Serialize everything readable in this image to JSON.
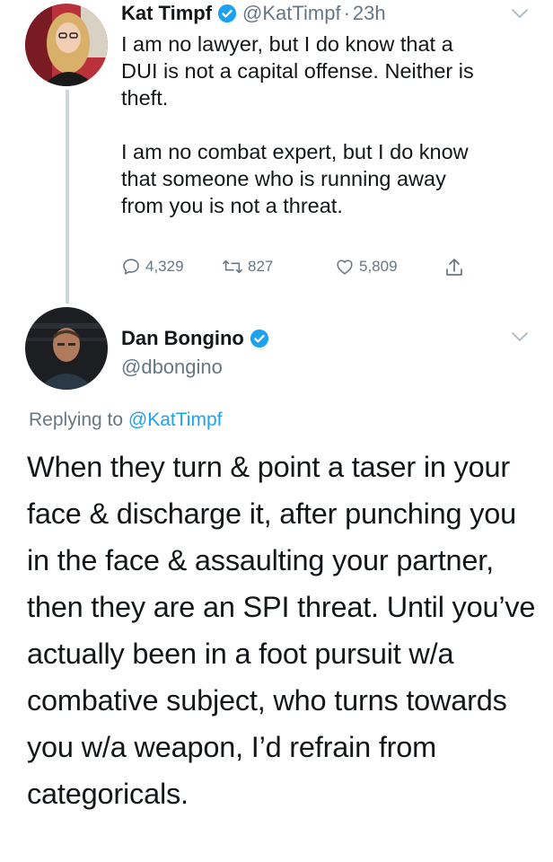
{
  "parent_tweet": {
    "display_name": "Kat Timpf",
    "handle": "@KatTimpf",
    "separator": "·",
    "time": "23h",
    "text": "I am no lawyer, but I do know that a\nDUI is not a capital offense. Neither is\ntheft.\n\nI am no combat expert, but I do know\nthat someone who is running away\nfrom you is not a threat.",
    "replies": "4,329",
    "retweets": "827",
    "likes": "5,809",
    "verified_icon": "verified-badge-icon",
    "menu_icon": "chevron-down-icon"
  },
  "reply_tweet": {
    "display_name": "Dan Bongino",
    "handle": "@dbongino",
    "replying_prefix": "Replying to",
    "replying_mention": "@KatTimpf",
    "text": "When they turn & point a taser in your face & discharge it, after punching you in the face & assaulting your partner, then they are an SPI threat. Until you’ve actually been in a foot pursuit w/a combative subject, who turns towards you w/a weapon, I’d refrain from categoricals.",
    "verified_icon": "verified-badge-icon",
    "menu_icon": "chevron-down-icon"
  },
  "colors": {
    "text": "#14171a",
    "secondary": "#657786",
    "link": "#1da1f2",
    "verified": "#1da1f2",
    "thread_line": "#ccd6dd"
  }
}
